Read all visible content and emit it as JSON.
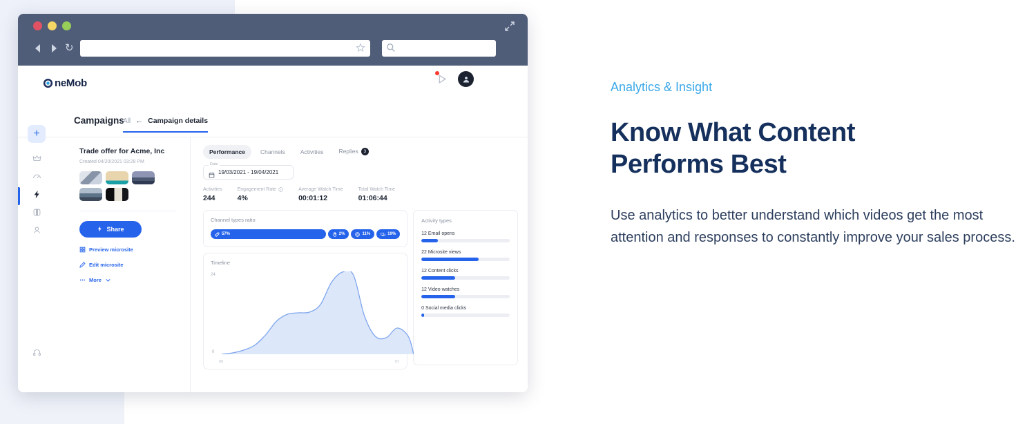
{
  "browser": {
    "traffic_lights": [
      "close",
      "minimize",
      "maximize"
    ],
    "back_icon": "back-arrow-icon",
    "forward_icon": "forward-arrow-icon",
    "reload_icon": "reload-icon",
    "url_value": "",
    "url_placeholder": "",
    "bookmark_icon": "star-icon",
    "search_value": "",
    "search_placeholder": "",
    "search_icon": "search-icon",
    "expand_icon": "expand-icon"
  },
  "app": {
    "logo_text": "neMob",
    "logo_mark": "onemob-logo-icon",
    "notification_icon": "notification-icon",
    "avatar_icon": "user-avatar",
    "rail": [
      {
        "name": "add",
        "icon": "plus-icon",
        "label": "+"
      },
      {
        "name": "crown",
        "icon": "crown-icon"
      },
      {
        "name": "dashboard",
        "icon": "gauge-icon"
      },
      {
        "name": "campaigns",
        "icon": "lightning-icon"
      },
      {
        "name": "library",
        "icon": "layers-icon"
      },
      {
        "name": "contacts",
        "icon": "person-icon"
      },
      {
        "name": "support",
        "icon": "headset-icon"
      }
    ],
    "nav": {
      "campaigns_label": "Campaigns",
      "all_label": "All",
      "back_arrow": "←",
      "details_label": "Campaign details"
    }
  },
  "campaign": {
    "title": "Trade offer for Acme, Inc",
    "created": "Created 04/20/2021 03:28 PM",
    "thumbnails": [
      "thumb-1",
      "thumb-2",
      "thumb-3",
      "thumb-4",
      "thumb-5"
    ],
    "share_label": "Share",
    "share_icon": "lightning-icon",
    "preview_label": "Preview microsite",
    "preview_icon": "grid-icon",
    "edit_label": "Edit microsite",
    "edit_icon": "pencil-icon",
    "more_label": "More",
    "more_icon": "chevron-down-icon"
  },
  "content": {
    "tabs": [
      {
        "label": "Performance",
        "active": true
      },
      {
        "label": "Channels",
        "active": false
      },
      {
        "label": "Activities",
        "active": false
      },
      {
        "label": "Replies",
        "active": false,
        "badge": "3"
      }
    ],
    "date": {
      "label": "Date",
      "value": "19/03/2021 - 19/04/2021",
      "icon": "calendar-icon"
    },
    "stats": [
      {
        "label": "Activities",
        "value": "244"
      },
      {
        "label": "Engagement Rate",
        "value": "4%",
        "icon": "info-icon"
      },
      {
        "label": "Average Watch Time",
        "value": "00:01:12"
      },
      {
        "label": "Total Watch Time",
        "value": "01:06:44"
      }
    ],
    "ratio": {
      "title": "Channel types ratio",
      "segments": [
        {
          "icon": "link-icon",
          "label": "57%",
          "value": 57
        },
        {
          "icon": "hand-icon",
          "label": "2%",
          "value": 2
        },
        {
          "icon": "at-icon",
          "label": "11%",
          "value": 11
        },
        {
          "icon": "message-icon",
          "label": "19%",
          "value": 19
        }
      ]
    },
    "activity": {
      "title": "Activity types",
      "items": [
        {
          "label": "12 Email opens",
          "count": 12,
          "pct": 19
        },
        {
          "label": "22 Microsite views",
          "count": 22,
          "pct": 65
        },
        {
          "label": "12 Content clicks",
          "count": 12,
          "pct": 38
        },
        {
          "label": "12 Video watches",
          "count": 12,
          "pct": 38
        },
        {
          "label": "0 Social media clicks",
          "count": 0,
          "pct": 3
        }
      ]
    }
  },
  "chart_data": {
    "type": "area",
    "title": "Timeline",
    "xlabel": "",
    "ylabel": "",
    "xlim": [
      0,
      7
    ],
    "ylim": [
      0,
      24
    ],
    "x_tick_labels": [
      "0d",
      "7d"
    ],
    "y_tick_labels": [
      "0",
      "24"
    ],
    "grid": false,
    "legend": "none",
    "line_color": "#7ea6ee",
    "fill_color": "#dde7fa",
    "x": [
      0,
      0.4,
      0.8,
      1.2,
      1.6,
      2.0,
      2.4,
      2.8,
      3.2,
      3.6,
      4.0,
      4.4,
      4.8,
      5.2,
      5.6,
      6.0,
      6.4,
      6.8,
      7.0
    ],
    "values": [
      0,
      0.4,
      1.2,
      2.6,
      5.6,
      9.6,
      11.6,
      12.0,
      12.2,
      14.4,
      20.8,
      23.8,
      23.0,
      11.2,
      5.2,
      4.8,
      7.6,
      5.2,
      0
    ]
  },
  "marketing": {
    "eyebrow": "Analytics & Insight",
    "headline_line1": "Know What Content",
    "headline_line2": "Performs Best",
    "body": "Use analytics to better understand which videos get the most attention and responses to constantly improve your sales process."
  },
  "colors": {
    "accent_blue": "#2563eb",
    "chrome": "#505d78",
    "eyebrow": "#3aa8e8",
    "headline": "#15305c",
    "body": "#2c3e5d",
    "chart_fill": "#dde7fa",
    "chart_line": "#7ea6ee"
  }
}
